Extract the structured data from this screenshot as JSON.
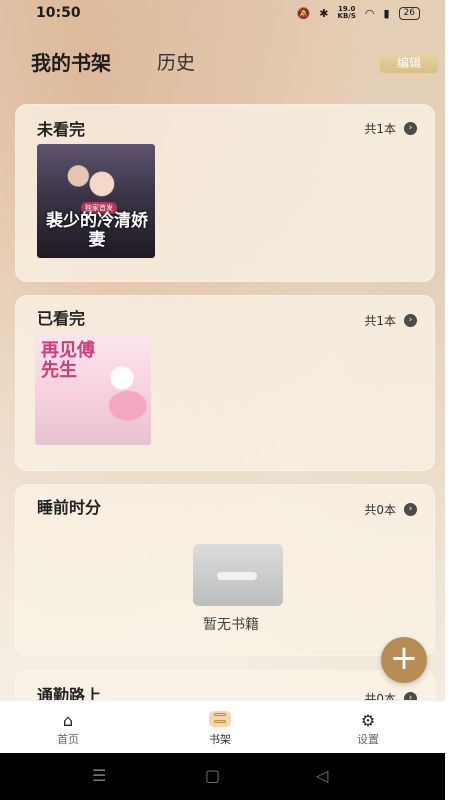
{
  "status_bar": {
    "time": "10:50",
    "speed_value": "19.0",
    "speed_unit": "KB/S",
    "battery": "26"
  },
  "header": {
    "tab_bookshelf": "我的书架",
    "tab_history": "历史",
    "edit_label": "编辑"
  },
  "shelves": [
    {
      "title": "未看完",
      "count": "共1本",
      "book": {
        "cover_text": "裴少的冷清娇妻",
        "badge": "独家首发"
      }
    },
    {
      "title": "已看完",
      "count": "共1本",
      "book": {
        "cover_text": "再见傅先生"
      }
    },
    {
      "title": "睡前时分",
      "count": "共0本",
      "empty_text": "暂无书籍"
    },
    {
      "title": "通勤路上",
      "count": "共0本"
    }
  ],
  "fab": {
    "icon": "plus-icon",
    "label": "+"
  },
  "bottom_nav": [
    {
      "label": "首页",
      "icon": "home-icon"
    },
    {
      "label": "书架",
      "icon": "bookshelf-icon",
      "active": true
    },
    {
      "label": "设置",
      "icon": "settings-icon"
    }
  ],
  "colors": {
    "accent": "#b88d55",
    "edit_button": "#dcc28b",
    "active_nav_bg": "#f3d7b0"
  }
}
